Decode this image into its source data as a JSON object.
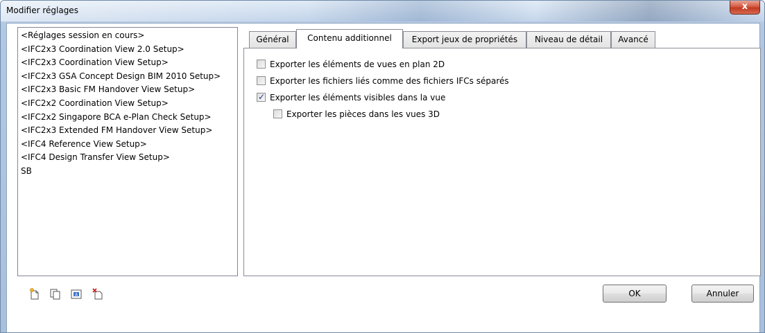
{
  "window": {
    "title": "Modifier réglages",
    "close_label": "x"
  },
  "setups": [
    "<Réglages session en cours>",
    "<IFC2x3 Coordination View 2.0 Setup>",
    "<IFC2x3 Coordination View Setup>",
    "<IFC2x3 GSA Concept Design BIM 2010 Setup>",
    "<IFC2x3 Basic FM Handover View Setup>",
    "<IFC2x2 Coordination View Setup>",
    "<IFC2x2 Singapore BCA e-Plan Check Setup>",
    "<IFC2x3 Extended FM Handover View Setup>",
    "<IFC4 Reference View Setup>",
    "<IFC4 Design Transfer View Setup>",
    "SB"
  ],
  "tabs": [
    "Général",
    "Contenu additionnel",
    "Export jeux de propriétés",
    "Niveau de détail",
    "Avancé"
  ],
  "active_tab": "Contenu additionnel",
  "options": [
    {
      "label": "Exporter les éléments de vues en plan 2D",
      "checked": false
    },
    {
      "label": "Exporter les fichiers liés comme des fichiers IFCs séparés",
      "checked": false
    },
    {
      "label": "Exporter les éléments visibles dans la vue",
      "checked": true
    },
    {
      "label": "Exporter les pièces dans les vues 3D",
      "checked": false
    }
  ],
  "bottom_icons": [
    "new-setup-icon",
    "duplicate-setup-icon",
    "rename-setup-icon",
    "delete-setup-icon"
  ],
  "buttons": {
    "ok": "OK",
    "cancel": "Annuler"
  },
  "colors": {
    "title_bar": "#b7cce6",
    "close_button": "#c13a22",
    "checkmark": "#1f3f86"
  }
}
